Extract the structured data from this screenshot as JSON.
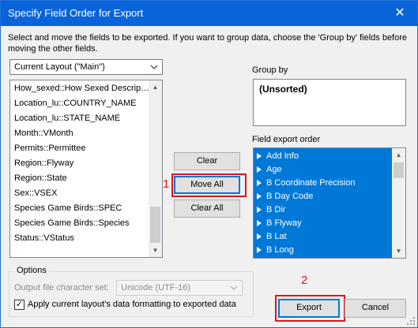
{
  "window": {
    "title": "Specify Field Order for Export",
    "close_glyph": "✕",
    "instructions": "Select and move the fields to be exported.  If you want to group data, choose the 'Group by' fields before moving the other fields."
  },
  "layout_select": {
    "value": "Current Layout (\"Main\")"
  },
  "source_fields": [
    "How_sexed::How Sexed Descrip…",
    "Location_lu::COUNTRY_NAME",
    "Location_lu::STATE_NAME",
    "Month::VMonth",
    "Permits::Permittee",
    "Region::Flyway",
    "Region::State",
    "Sex::VSEX",
    "Species Game Birds::SPEC",
    "Species Game Birds::Species",
    "Status::VStatus"
  ],
  "buttons": {
    "clear": "Clear",
    "move_all": "Move All",
    "clear_all": "Clear All",
    "export": "Export",
    "cancel": "Cancel"
  },
  "annotations": {
    "one": "1",
    "two": "2",
    "color": "#e0141b"
  },
  "group_by": {
    "label": "Group by",
    "value": "(Unsorted)"
  },
  "export_order": {
    "label": "Field export order",
    "items": [
      "Add Info",
      "Age",
      "B Coordinate Precision",
      "B Day Code",
      "B Dir",
      "B Flyway",
      "B Lat",
      "B Long"
    ]
  },
  "options": {
    "legend": "Options",
    "charset_label": "Output file character set:",
    "charset_value": "Unicode (UTF-16)",
    "apply_formatting_label": "Apply current layout's data formatting to exported data",
    "apply_formatting_checked": true,
    "check_glyph": "✓"
  },
  "colors": {
    "titlebar": "#0a64d9",
    "selection": "#0078d7",
    "annotation": "#e0141b"
  },
  "icons": [
    "close-icon",
    "chevron-down-icon",
    "scroll-up-arrow-icon",
    "scroll-down-arrow-icon",
    "checkmark-icon",
    "resize-grip-icon"
  ]
}
